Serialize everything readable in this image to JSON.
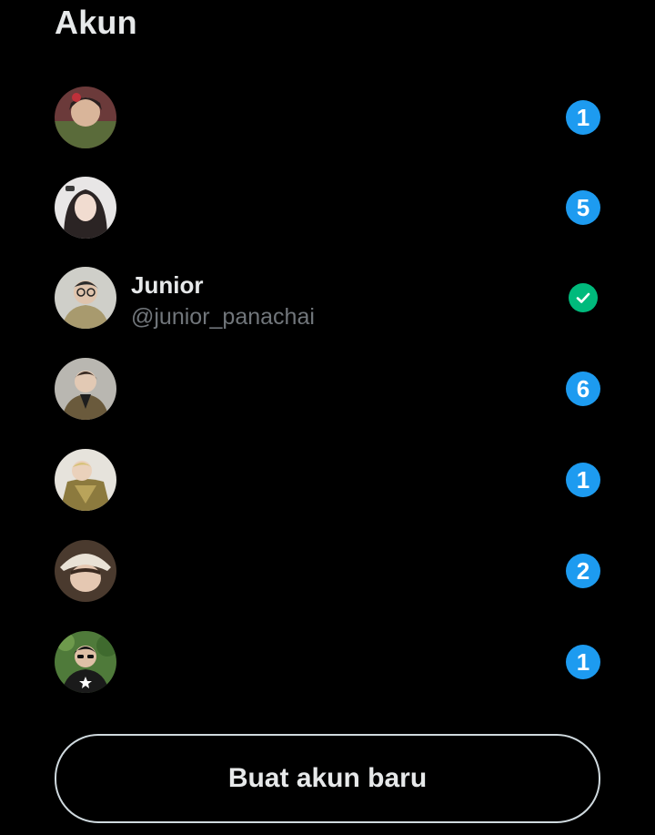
{
  "header": {
    "title": "Akun"
  },
  "accounts": [
    {
      "badge": "1",
      "active": false
    },
    {
      "badge": "5",
      "active": false
    },
    {
      "name": "Junior",
      "handle": "@junior_panachai",
      "active": true,
      "status_icon": "check-icon"
    },
    {
      "badge": "6",
      "active": false
    },
    {
      "badge": "1",
      "active": false
    },
    {
      "badge": "2",
      "active": false
    },
    {
      "badge": "1",
      "active": false
    }
  ],
  "actions": {
    "create_account_label": "Buat akun baru"
  },
  "colors": {
    "background": "#000000",
    "badge": "#1d9bf0",
    "active_check": "#00ba7c",
    "text_primary": "#e7e9ea",
    "text_secondary": "#71767b",
    "button_border": "#cfd9de"
  }
}
